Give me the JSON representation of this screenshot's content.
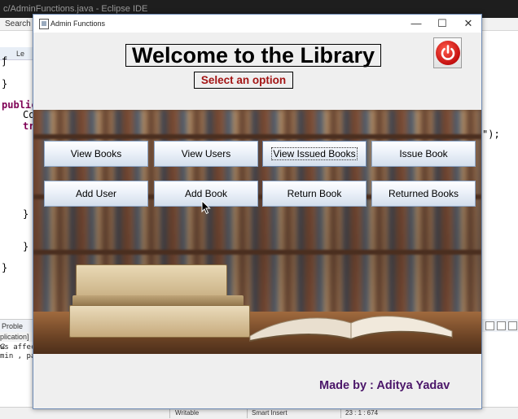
{
  "ide": {
    "title": "c/AdminFunctions.java - Eclipse IDE",
    "menu": "Search",
    "editor_tab": "Le",
    "code_lines": [
      "}",
      "public",
      "Co",
      "tr"
    ],
    "code_tail": "\");",
    "closing_braces": [
      "}",
      "}",
      "}"
    ],
    "bottom_tab": "Proble",
    "bottom_tab2": "plication] C",
    "console_lines": [
      "ws affec",
      "min , pa"
    ],
    "status": {
      "writable": "Writable",
      "insert_mode": "Smart Insert",
      "position": "23 : 1 : 674"
    }
  },
  "window": {
    "title": "Admin Functions",
    "controls": {
      "minimize": "—",
      "maximize": "☐",
      "close": "✕"
    },
    "heading": "Welcome to the Library",
    "subheading": "Select an option",
    "buttons_row1": [
      "View Books",
      "View Users",
      "View Issued Books",
      "Issue Book"
    ],
    "buttons_row2": [
      "Add User",
      "Add Book",
      "Return Book",
      "Returned Books"
    ],
    "credit": "Made by : Aditya Yadav",
    "colors": {
      "heading": "#000000",
      "subheading": "#a31515",
      "credit": "#4b1669",
      "power": "#c40f0f"
    }
  }
}
